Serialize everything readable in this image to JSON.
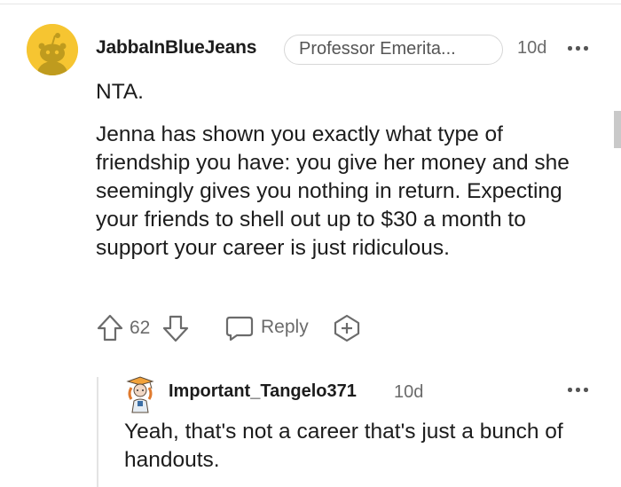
{
  "comment": {
    "username": "JabbaInBlueJeans",
    "flair": "Professor Emerita...",
    "time": "10d",
    "body": [
      "NTA.",
      "Jenna has shown you exactly what type of friendship you have: you give her money and she seemingly gives you nothing in return. Expecting your friends to shell out up to $30 a month to support your career is just ridiculous."
    ],
    "votes": "62",
    "reply_label": "Reply"
  },
  "reply": {
    "username": "Important_Tangelo371",
    "time": "10d",
    "body": "Yeah, that's not a career that's just a bunch of handouts."
  },
  "colors": {
    "avatar_bg": "#f6c531",
    "text": "#1c1c1c",
    "meta": "#6b6b6b"
  }
}
